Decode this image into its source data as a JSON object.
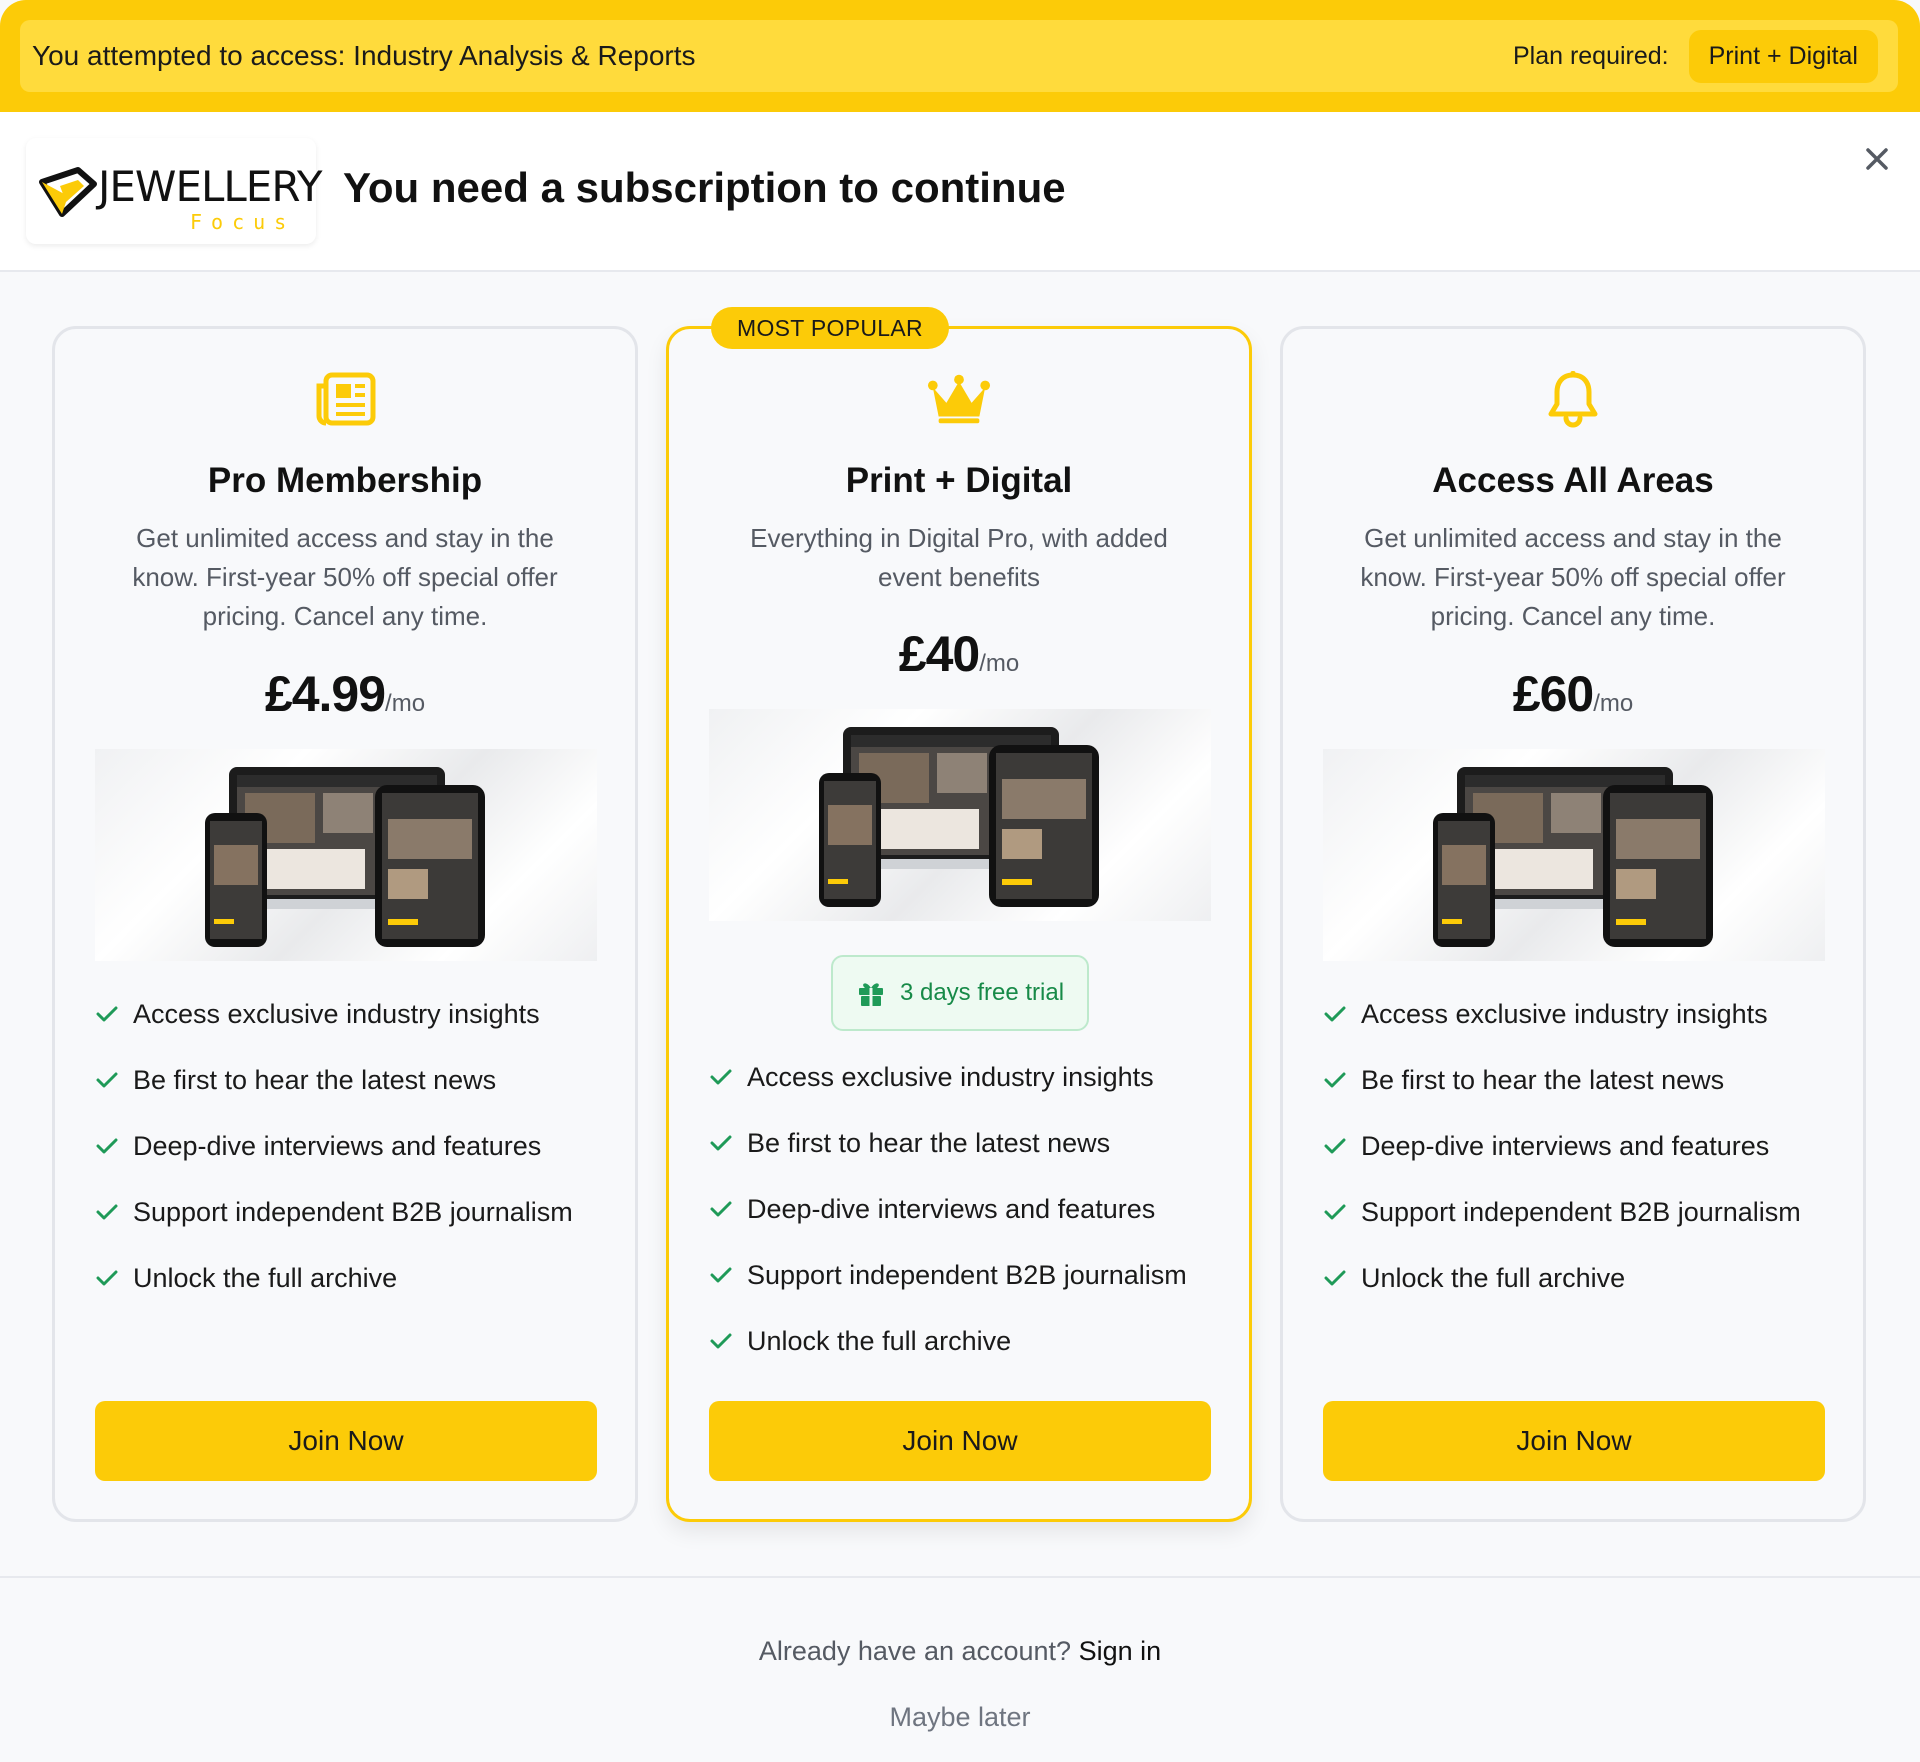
{
  "banner": {
    "text": "You attempted to access: Industry Analysis & Reports",
    "plan_label": "Plan required:",
    "plan_value": "Print + Digital"
  },
  "header": {
    "logo_word": "JEWELLERY",
    "logo_sub": "Focus",
    "title": "You need a subscription to continue",
    "close_icon": "close-icon"
  },
  "plans": [
    {
      "icon": "newspaper-icon",
      "name": "Pro Membership",
      "description": "Get unlimited access and stay in the know. First-year 50% off special offer pricing. Cancel any time.",
      "price": "£4.99",
      "per": "/mo",
      "features": [
        "Access exclusive industry insights",
        "Be first to hear the latest news",
        "Deep-dive interviews and features",
        "Support independent B2B journalism",
        "Unlock the full archive"
      ],
      "button": "Join Now"
    },
    {
      "icon": "crown-icon",
      "badge": "MOST POPULAR",
      "name": "Print + Digital",
      "description": "Everything in Digital Pro, with added event benefits",
      "price": "£40",
      "per": "/mo",
      "trial": "3 days free trial",
      "features": [
        "Access exclusive industry insights",
        "Be first to hear the latest news",
        "Deep-dive interviews and features",
        "Support independent B2B journalism",
        "Unlock the full archive"
      ],
      "button": "Join Now"
    },
    {
      "icon": "bell-icon",
      "name": "Access All Areas",
      "description": "Get unlimited access and stay in the know. First-year 50% off special offer pricing. Cancel any time.",
      "price": "£60",
      "per": "/mo",
      "features": [
        "Access exclusive industry insights",
        "Be first to hear the latest news",
        "Deep-dive interviews and features",
        "Support independent B2B journalism",
        "Unlock the full archive"
      ],
      "button": "Join Now"
    }
  ],
  "footer": {
    "prompt": "Already have an account?",
    "signin": "Sign in",
    "later": "Maybe later"
  },
  "colors": {
    "brand_yellow": "#fccb08",
    "check_green": "#1f9a58",
    "trial_green": "#178a48"
  }
}
